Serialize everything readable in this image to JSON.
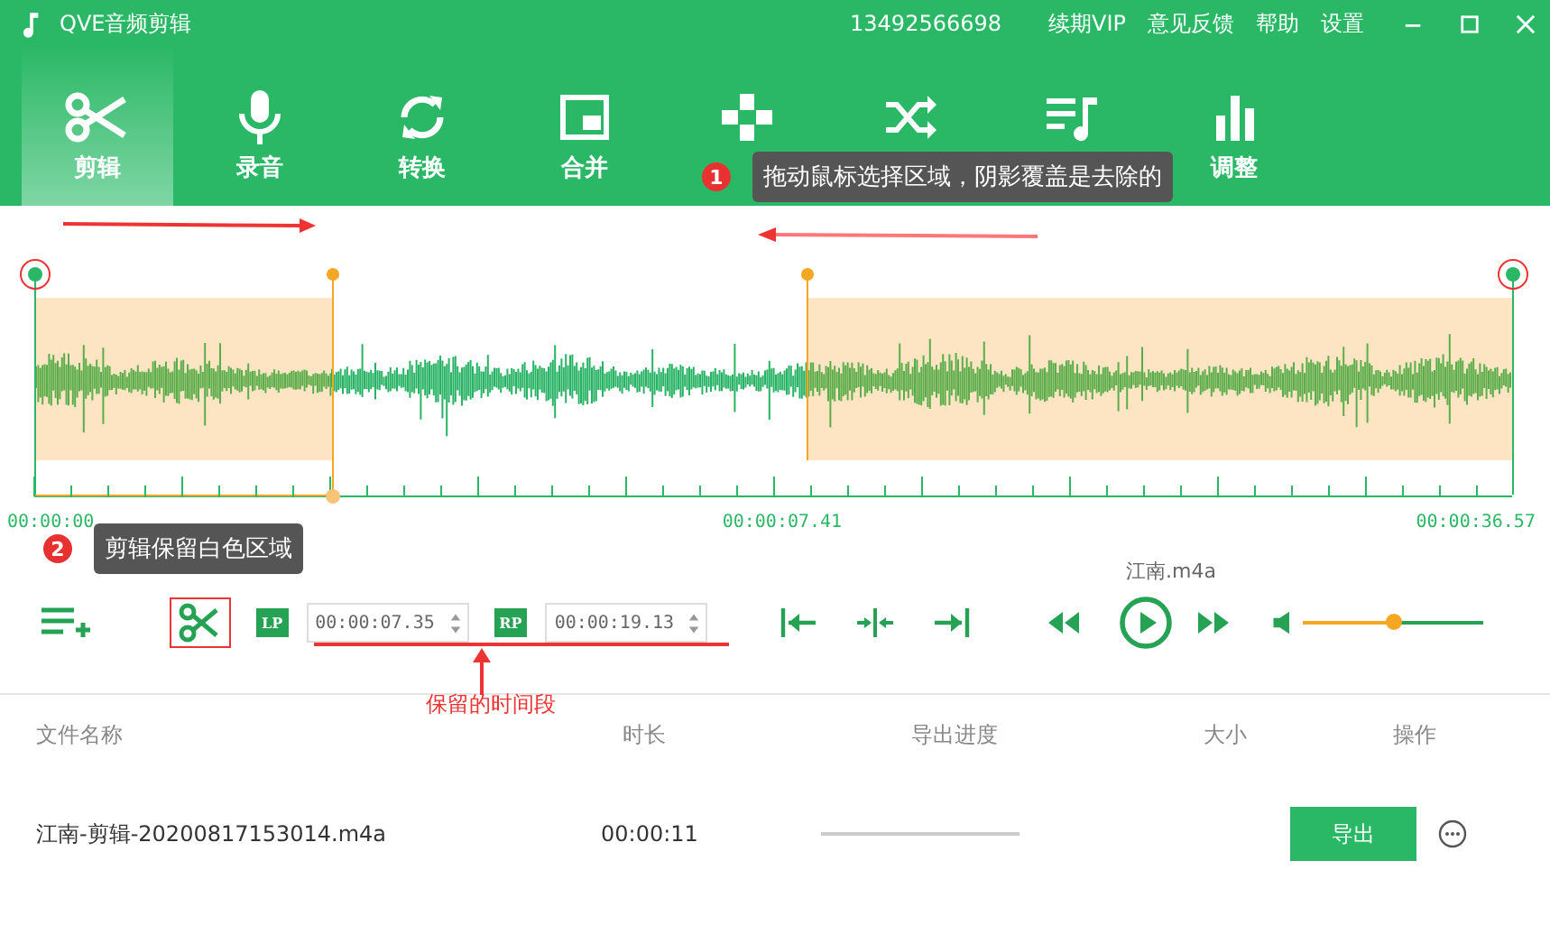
{
  "window": {
    "title": "QVE音频剪辑",
    "account": "13492566698",
    "links": [
      "续期VIP",
      "意见反馈",
      "帮助",
      "设置"
    ]
  },
  "tabs": [
    {
      "kind": "scissors",
      "label": "剪辑",
      "selected": true
    },
    {
      "kind": "mic",
      "label": "录音",
      "selected": false
    },
    {
      "kind": "convert",
      "label": "转换",
      "selected": false
    },
    {
      "kind": "merge",
      "label": "合并",
      "selected": false
    },
    {
      "kind": "speed",
      "selected": false
    },
    {
      "kind": "mix",
      "selected": false
    },
    {
      "kind": "music",
      "selected": false
    },
    {
      "kind": "equalizer",
      "label": "调整",
      "selected": false
    }
  ],
  "editor": {
    "time_labels": [
      "00:00:00",
      "00:00:07.41",
      "00:00:36.57"
    ],
    "file_name": "江南.m4a",
    "lp_badge": "LP",
    "lp_value": "00:00:07.35",
    "rp_badge": "RP",
    "rp_value": "00:00:19.13",
    "volume": {
      "level": 0.5
    }
  },
  "annotations": [
    {
      "badge": "1",
      "text": "拖动鼠标选择区域，阴影覆盖是去除的"
    },
    {
      "badge": "2",
      "text": "剪辑保留白色区域"
    }
  ],
  "note": "保留的时间段",
  "table": {
    "columns": [
      "文件名称",
      "时长",
      "导出进度",
      "大小",
      "操作"
    ],
    "rows": [
      {
        "name": "江南-剪辑-20200817153014.m4a",
        "duration": "00:00:11",
        "progress": {
          "level": 0
        },
        "action": "导出"
      }
    ]
  }
}
